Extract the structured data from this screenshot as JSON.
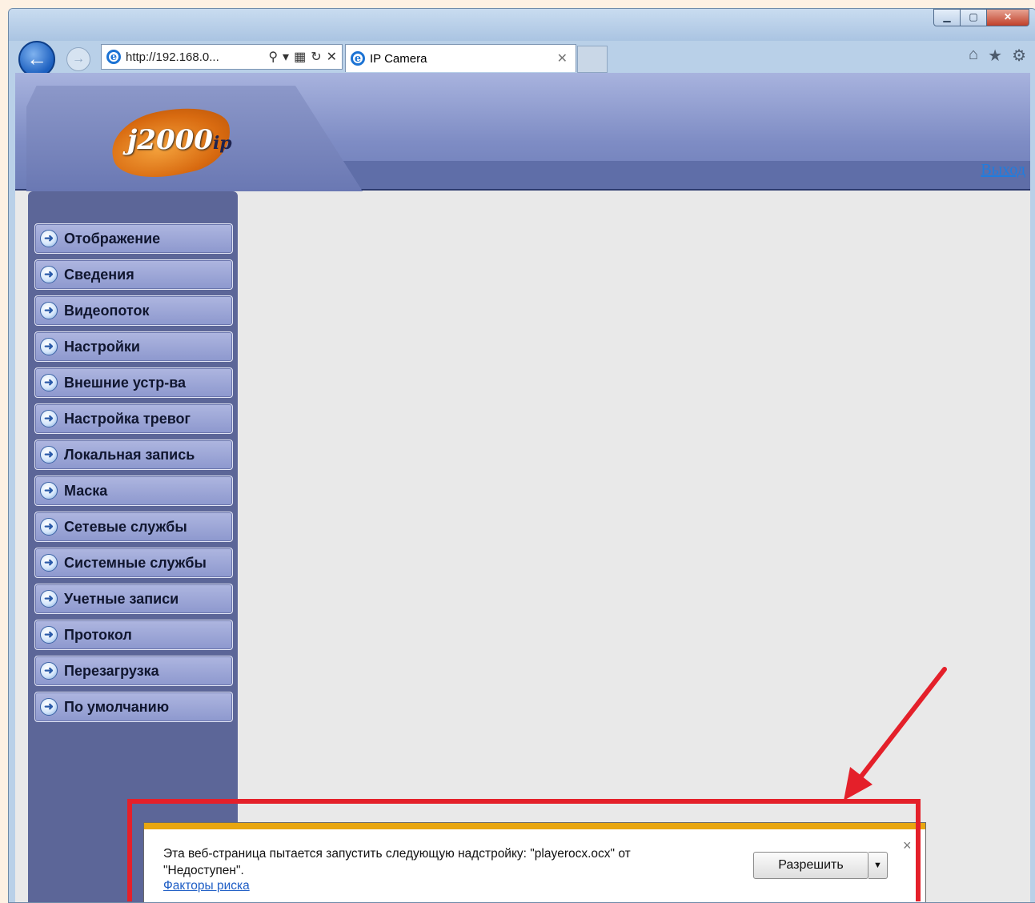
{
  "browser": {
    "address": "http://192.168.0...",
    "tab_title": "IP Camera",
    "window_controls": [
      "minimize-icon",
      "maximize-icon",
      "close-icon"
    ],
    "right_icons": [
      "home-icon",
      "favorites-star-icon",
      "settings-gear-icon"
    ]
  },
  "page": {
    "logo_text": "j2000",
    "logo_suffix": "ip",
    "logout_label": "Выход",
    "menu": [
      {
        "label": "Отображение"
      },
      {
        "label": "Сведения"
      },
      {
        "label": "Видеопоток"
      },
      {
        "label": "Настройки"
      },
      {
        "label": "Внешние устр-ва"
      },
      {
        "label": "Настройка тревог"
      },
      {
        "label": "Локальная запись"
      },
      {
        "label": "Маска"
      },
      {
        "label": "Сетевые службы"
      },
      {
        "label": "Системные службы"
      },
      {
        "label": "Учетные записи"
      },
      {
        "label": "Протокол"
      },
      {
        "label": "Перезагрузка"
      },
      {
        "label": "По умолчанию"
      }
    ]
  },
  "notification": {
    "message_line1": "Эта веб-страница пытается запустить следующую надстройку: \"playerocx.ocx\" от",
    "message_line2": "\"Недоступен\".",
    "risk_link": "Факторы риска",
    "allow_label": "Разрешить",
    "close_glyph": "×"
  },
  "colors": {
    "annotation_red": "#e4202a",
    "notification_stripe": "#e8a610",
    "sidebar": "#5c6698"
  }
}
